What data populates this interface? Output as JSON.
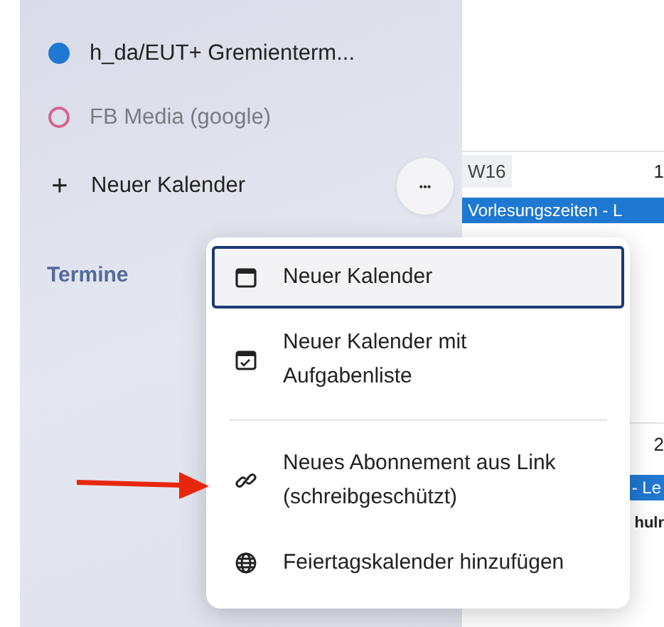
{
  "sidebar": {
    "calendars": [
      {
        "name": "h_da/EUT+ Gremienterm...",
        "color": "#1f78d1",
        "visible": true
      },
      {
        "name": "FB Media (google)",
        "color": "#d4648f",
        "visible": false
      }
    ],
    "new_calendar": {
      "icon": "+",
      "label": "Neuer Kalender"
    },
    "more_button": "•••",
    "section_title": "Termine"
  },
  "calendar": {
    "week_label": "W16",
    "day_1": "1",
    "event_1": "Vorlesungszeiten - L",
    "day_2": "2",
    "event_2": "- Le",
    "event_3": "hulr"
  },
  "menu": {
    "sections": [
      [
        {
          "kind": "calendar",
          "label": "Neuer Kalender",
          "selected": true
        },
        {
          "kind": "task-calendar",
          "label": "Neuer Kalender mit Aufgabenliste",
          "selected": false
        }
      ],
      [
        {
          "kind": "subscription",
          "label": "Neues Abonnement aus Link (schreibgeschützt)",
          "selected": false
        },
        {
          "kind": "holidays",
          "label": "Feiertagskalender hinzufügen",
          "selected": false
        }
      ]
    ]
  }
}
